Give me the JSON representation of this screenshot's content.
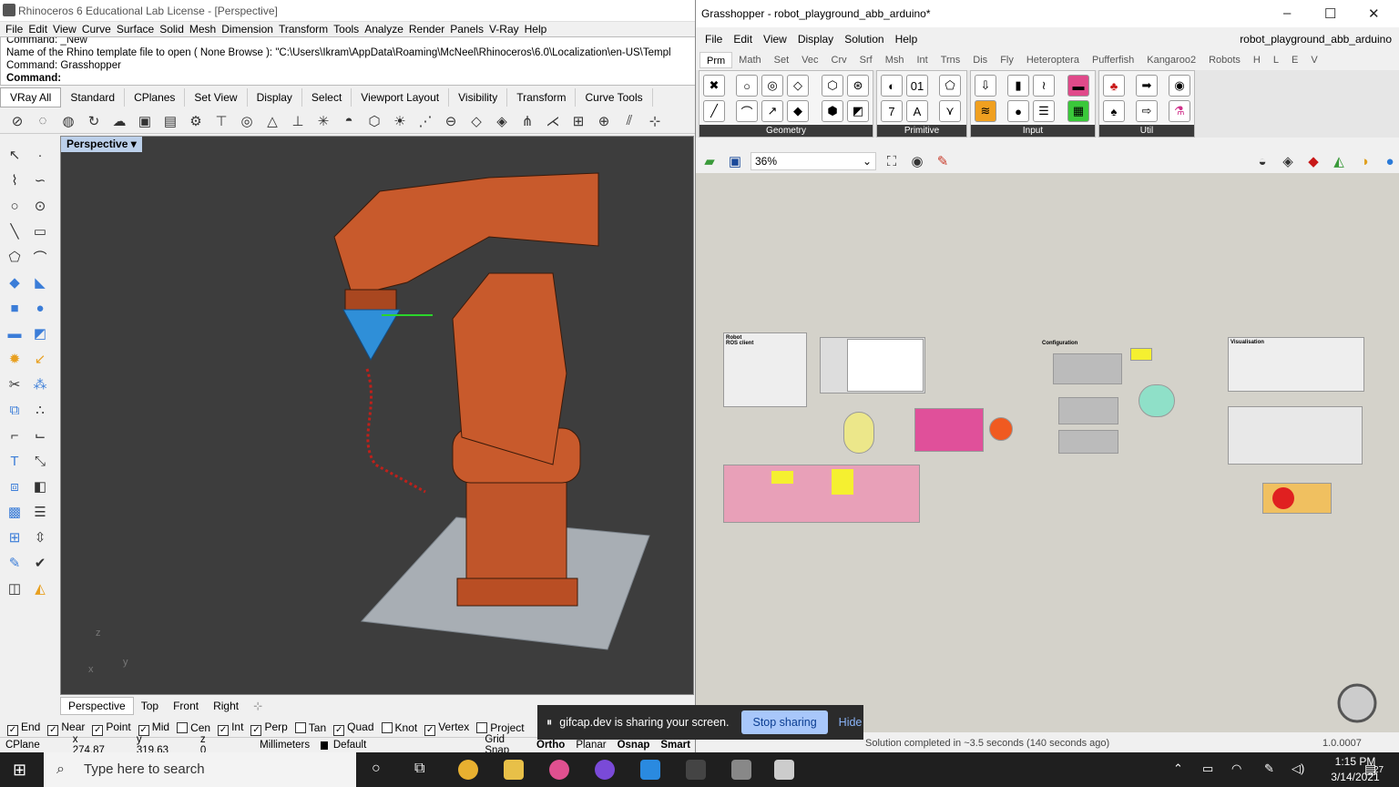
{
  "rhino": {
    "title": "Rhinoceros 6 Educational Lab License - [Perspective]",
    "menu": [
      "File",
      "Edit",
      "View",
      "Curve",
      "Surface",
      "Solid",
      "Mesh",
      "Dimension",
      "Transform",
      "Tools",
      "Analyze",
      "Render",
      "Panels",
      "V-Ray",
      "Help"
    ],
    "command_history": [
      "Command: _New",
      "Name of the Rhino template file to open ( None  Browse ): \"C:\\Users\\Ikram\\AppData\\Roaming\\McNeel\\Rhinoceros\\6.0\\Localization\\en-US\\Templ",
      "Command: Grasshopper"
    ],
    "command_prompt": "Command:",
    "tabs": [
      "VRay All",
      "Standard",
      "CPlanes",
      "Set View",
      "Display",
      "Select",
      "Viewport Layout",
      "Visibility",
      "Transform",
      "Curve Tools"
    ],
    "viewport_label": "Perspective",
    "viewport_tabs": [
      "Perspective",
      "Top",
      "Front",
      "Right"
    ],
    "osnaps": [
      {
        "label": "End",
        "checked": true
      },
      {
        "label": "Near",
        "checked": true
      },
      {
        "label": "Point",
        "checked": true
      },
      {
        "label": "Mid",
        "checked": true
      },
      {
        "label": "Cen",
        "checked": false
      },
      {
        "label": "Int",
        "checked": true
      },
      {
        "label": "Perp",
        "checked": true
      },
      {
        "label": "Tan",
        "checked": false
      },
      {
        "label": "Quad",
        "checked": true
      },
      {
        "label": "Knot",
        "checked": false
      },
      {
        "label": "Vertex",
        "checked": true
      },
      {
        "label": "Project",
        "checked": false
      }
    ],
    "status": {
      "cplane": "CPlane",
      "x": "x 274.87",
      "y": "y 319.63",
      "z": "z 0",
      "units": "Millimeters",
      "layer": "Default",
      "grid_snap": "Grid Snap",
      "ortho": "Ortho",
      "planar": "Planar",
      "osnap": "Osnap",
      "smart": "Smart"
    }
  },
  "grasshopper": {
    "title": "Grasshopper - robot_playground_abb_arduino*",
    "menu": [
      "File",
      "Edit",
      "View",
      "Display",
      "Solution",
      "Help"
    ],
    "doc_name": "robot_playground_abb_arduino",
    "tabs": [
      "Prm",
      "Math",
      "Set",
      "Vec",
      "Crv",
      "Srf",
      "Msh",
      "Int",
      "Trns",
      "Dis",
      "Fly",
      "Heteroptera",
      "Pufferfish",
      "Kangaroo2",
      "Robots",
      "H",
      "L",
      "E",
      "V"
    ],
    "groups": [
      "Geometry",
      "Primitive",
      "Input",
      "Util"
    ],
    "zoom": "36%",
    "status": "Solution completed in ~3.5 seconds (140 seconds ago)",
    "version": "1.0.0007",
    "canvas_labels": {
      "robot": "Robot",
      "ros": "ROS client",
      "config": "Configuration",
      "visual": "Visualisation"
    }
  },
  "share_bar": {
    "message": "gifcap.dev is sharing your screen.",
    "stop": "Stop sharing",
    "hide": "Hide"
  },
  "taskbar": {
    "search_placeholder": "Type here to search",
    "time": "1:15 PM",
    "date": "3/14/2021",
    "notifications": "27"
  }
}
